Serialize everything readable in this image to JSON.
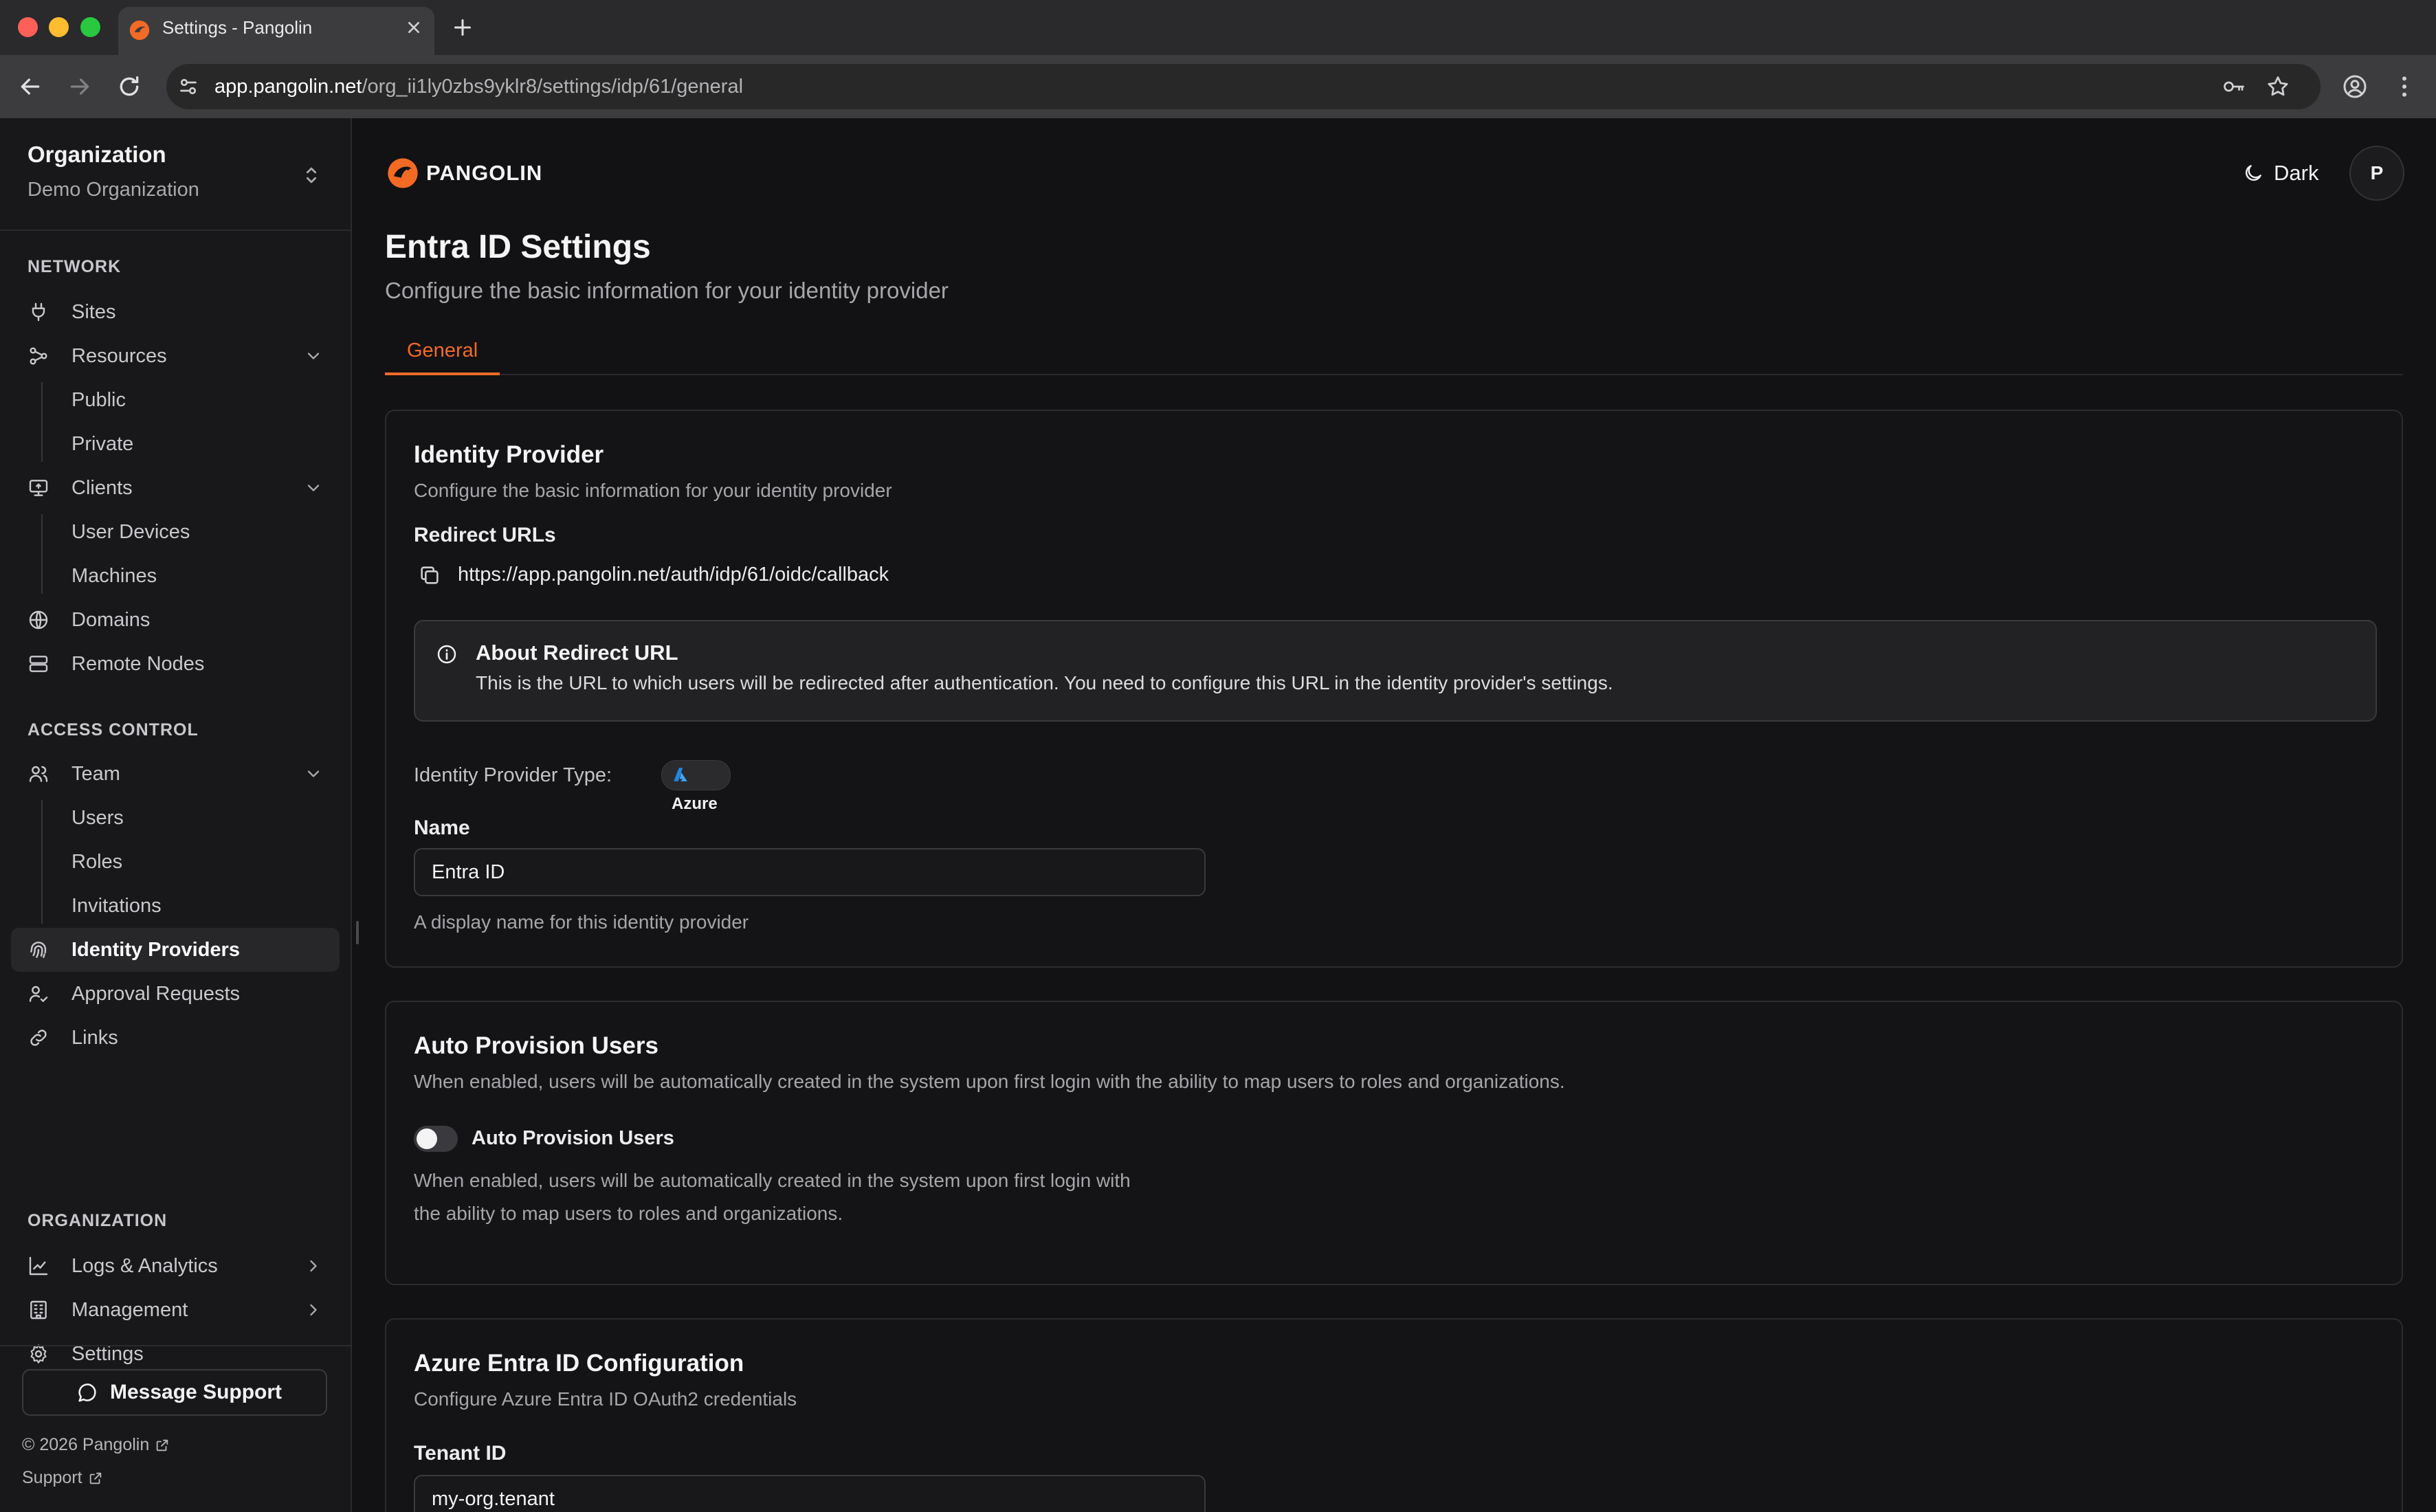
{
  "browser": {
    "tab_title": "Settings - Pangolin",
    "url_host": "app.pangolin.net",
    "url_path": "/org_ii1ly0zbs9yklr8/settings/idp/61/general"
  },
  "sidebar": {
    "org_label": "Organization",
    "org_name": "Demo Organization",
    "sections": {
      "network": "NETWORK",
      "access_control": "ACCESS CONTROL",
      "organization": "ORGANIZATION"
    },
    "items": {
      "sites": "Sites",
      "resources": "Resources",
      "public": "Public",
      "private": "Private",
      "clients": "Clients",
      "user_devices": "User Devices",
      "machines": "Machines",
      "domains": "Domains",
      "remote_nodes": "Remote Nodes",
      "team": "Team",
      "users": "Users",
      "roles": "Roles",
      "invitations": "Invitations",
      "identity_providers": "Identity Providers",
      "approval_requests": "Approval Requests",
      "links": "Links",
      "logs_analytics": "Logs & Analytics",
      "management": "Management",
      "settings": "Settings"
    },
    "active_item": "Identity Providers",
    "message_support": "Message Support",
    "copyright": "© 2026 Pangolin",
    "support": "Support"
  },
  "header": {
    "brand": "PANGOLIN",
    "theme_label": "Dark",
    "avatar_initial": "P"
  },
  "page": {
    "title": "Entra ID Settings",
    "subtitle": "Configure the basic information for your identity provider",
    "tabs": [
      "General"
    ]
  },
  "identity_provider": {
    "title": "Identity Provider",
    "description": "Configure the basic information for your identity provider",
    "redirect_label": "Redirect URLs",
    "redirect_url": "https://app.pangolin.net/auth/idp/61/oidc/callback",
    "alert_title": "About Redirect URL",
    "alert_text": "This is the URL to which users will be redirected after authentication. You need to configure this URL in the identity provider's settings.",
    "type_label": "Identity Provider Type:",
    "type_value": "Azure",
    "name_label": "Name",
    "name_value": "Entra ID",
    "name_help": "A display name for this identity provider"
  },
  "auto_provision": {
    "title": "Auto Provision Users",
    "description": "When enabled, users will be automatically created in the system upon first login with the ability to map users to roles and organizations.",
    "toggle_label": "Auto Provision Users",
    "toggle_on": false,
    "help_line1": "When enabled, users will be automatically created in the system upon first login with",
    "help_line2": "the ability to map users to roles and organizations."
  },
  "azure_config": {
    "title": "Azure Entra ID Configuration",
    "description": "Configure Azure Entra ID OAuth2 credentials",
    "tenant_label": "Tenant ID",
    "tenant_value": "my-org.tenant"
  },
  "colors": {
    "accent": "#f36a24",
    "background": "#121214",
    "sidebar": "#18181a"
  }
}
